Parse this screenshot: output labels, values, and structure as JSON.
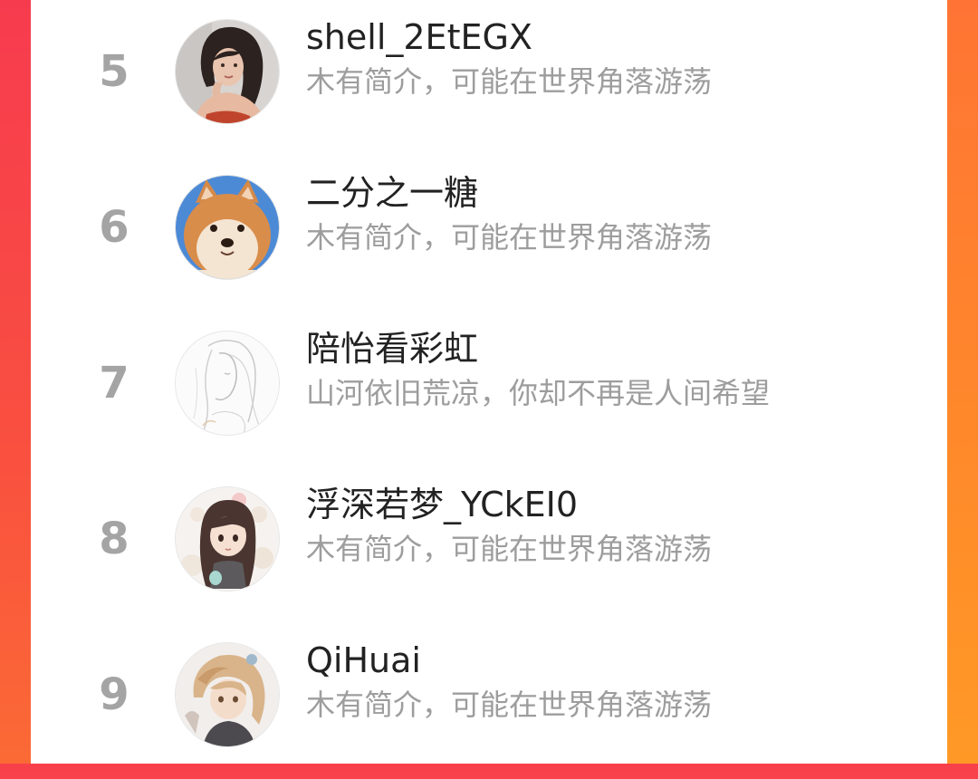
{
  "ranking": {
    "items": [
      {
        "rank": "5",
        "name": "shell_2EtEGX",
        "bio": "木有简介，可能在世界角落游荡",
        "avatar": "woman-photo-avatar"
      },
      {
        "rank": "6",
        "name": "二分之一糖",
        "bio": "木有简介，可能在世界角落游荡",
        "avatar": "shiba-dog-avatar"
      },
      {
        "rank": "7",
        "name": "陪怡看彩虹",
        "bio": "山河依旧荒凉，你却不再是人间希望",
        "avatar": "sketch-girl-avatar"
      },
      {
        "rank": "8",
        "name": "浮深若梦_YCkEI0",
        "bio": "木有简介，可能在世界角落游荡",
        "avatar": "anime-girl-avatar"
      },
      {
        "rank": "9",
        "name": "QiHuai",
        "bio": "木有简介，可能在世界角落游荡",
        "avatar": "anime-boy-avatar"
      }
    ]
  },
  "colors": {
    "background_left": "#f73b4f",
    "background_right": "#ff8a2a",
    "rank_number": "#a4a4a4",
    "name_text": "#222222",
    "bio_text": "#9d9d9d"
  }
}
